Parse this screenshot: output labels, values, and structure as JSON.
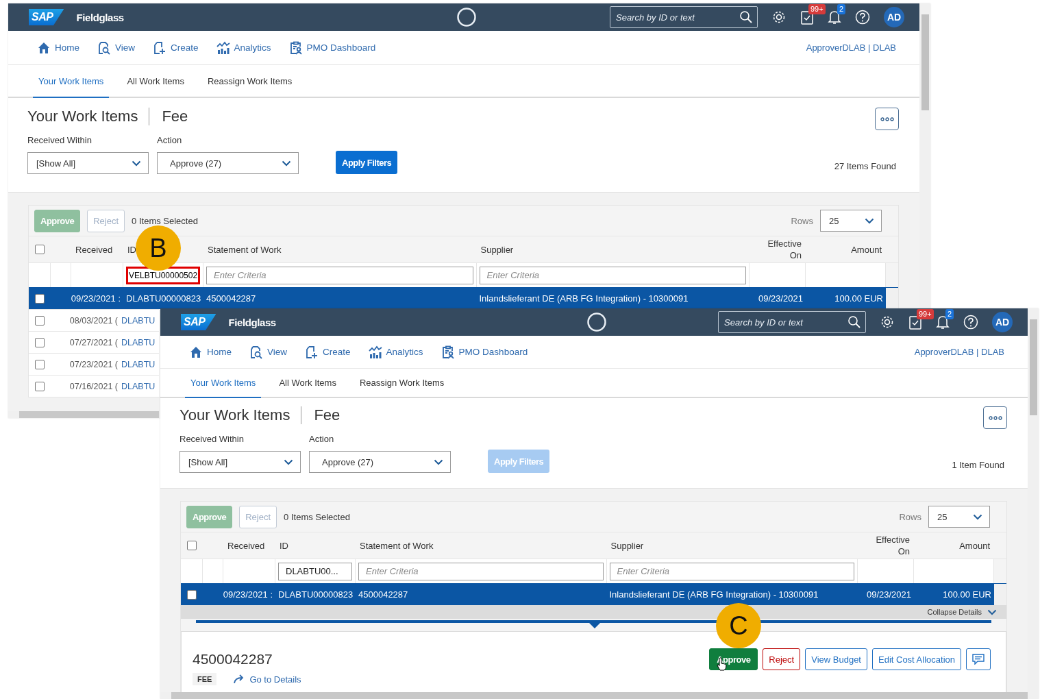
{
  "screens": [
    {
      "header": {
        "logo": "SAP",
        "product": "Fieldglass",
        "search": {
          "placeholder": "Search by ID or text"
        },
        "tasks_badge": "99+",
        "alerts_badge": "2",
        "avatar": "AD"
      },
      "nav": [
        {
          "label": "Home",
          "kind": "home"
        },
        {
          "label": "View",
          "kind": "view"
        },
        {
          "label": "Create",
          "kind": "create"
        },
        {
          "label": "Analytics",
          "kind": "analytics"
        },
        {
          "label": "PMO Dashboard",
          "kind": "dashboard"
        }
      ],
      "user": "ApproverDLAB | DLAB",
      "tabs": [
        {
          "label": "Your Work Items",
          "selected": true
        },
        {
          "label": "All Work Items",
          "selected": false
        },
        {
          "label": "Reassign Work Items",
          "selected": false
        }
      ],
      "title": "Your Work Items",
      "subtitle": "Fee",
      "filters": [
        {
          "label": "Received Within",
          "value": "[Show All]"
        },
        {
          "label": "Action",
          "value": "Approve (27)"
        }
      ],
      "apply_button": {
        "label": "Apply Filters",
        "disabled": false
      },
      "items_found": "27 Items Found",
      "toolbar": {
        "buttons": [
          {
            "label": "Approve",
            "kind": "approve",
            "disabled": true
          },
          {
            "label": "Reject",
            "kind": "reject",
            "disabled": true
          }
        ],
        "selected_count": "0 Items Selected",
        "rows_label": "Rows",
        "rows_value": "25"
      },
      "select_all": {
        "checked": false
      },
      "columns": [
        "Received",
        "ID",
        "Statement of Work",
        "Supplier",
        "Effective On",
        "Amount"
      ],
      "id_filter": {
        "value": "VELBTU00000502",
        "highlighted": true
      },
      "sow_filter": {
        "placeholder": "Enter Criteria"
      },
      "supplier_filter": {
        "placeholder": "Enter Criteria"
      },
      "rows": [
        {
          "received": "09/23/2021 :",
          "id": "DLABTU00000823",
          "statement_of_work": "4500042287",
          "supplier": "Inlandslieferant DE (ARB FG Integration) - 10300091",
          "effective_on": "09/23/2021",
          "amount": "100.00 EUR",
          "selected": true
        },
        {
          "received": "08/03/2021 (",
          "id": "DLABTU",
          "selected": false
        },
        {
          "received": "07/27/2021 (",
          "id": "DLABTU",
          "selected": false
        },
        {
          "received": "07/23/2021 (",
          "id": "DLABTU",
          "selected": false
        },
        {
          "received": "07/16/2021 (",
          "id": "DLABTU",
          "selected": false
        }
      ],
      "marker": "B"
    },
    {
      "header": {
        "logo": "SAP",
        "product": "Fieldglass",
        "search": {
          "placeholder": "Search by ID or text"
        },
        "tasks_badge": "99+",
        "alerts_badge": "2",
        "avatar": "AD"
      },
      "nav": [
        {
          "label": "Home",
          "kind": "home"
        },
        {
          "label": "View",
          "kind": "view"
        },
        {
          "label": "Create",
          "kind": "create"
        },
        {
          "label": "Analytics",
          "kind": "analytics"
        },
        {
          "label": "PMO Dashboard",
          "kind": "dashboard"
        }
      ],
      "user": "ApproverDLAB | DLAB",
      "tabs": [
        {
          "label": "Your Work Items",
          "selected": true
        },
        {
          "label": "All Work Items",
          "selected": false
        },
        {
          "label": "Reassign Work Items",
          "selected": false
        }
      ],
      "title": "Your Work Items",
      "subtitle": "Fee",
      "filters": [
        {
          "label": "Received Within",
          "value": "[Show All]"
        },
        {
          "label": "Action",
          "value": "Approve (27)"
        }
      ],
      "apply_button": {
        "label": "Apply Filters",
        "disabled": true
      },
      "items_found": "1 Item Found",
      "toolbar": {
        "buttons": [
          {
            "label": "Approve",
            "kind": "approve",
            "disabled": true
          },
          {
            "label": "Reject",
            "kind": "reject",
            "disabled": true
          }
        ],
        "selected_count": "0 Items Selected",
        "rows_label": "Rows",
        "rows_value": "25"
      },
      "select_all": {
        "checked": false
      },
      "columns": [
        "Received",
        "ID",
        "Statement of Work",
        "Supplier",
        "Effective On",
        "Amount"
      ],
      "id_filter": {
        "value": "DLABTU00...",
        "highlighted": false
      },
      "sow_filter": {
        "placeholder": "Enter Criteria"
      },
      "supplier_filter": {
        "placeholder": "Enter Criteria"
      },
      "rows": [
        {
          "received": "09/23/2021 :",
          "id": "DLABTU00000823",
          "statement_of_work": "4500042287",
          "supplier": "Inlandslieferant DE (ARB FG Integration) - 10300091",
          "effective_on": "09/23/2021",
          "amount": "100.00 EUR",
          "selected": true
        }
      ],
      "details": {
        "collapse": "Collapse Details",
        "number": "4500042287",
        "tag": "FEE",
        "link": "Go to Details",
        "buttons": [
          {
            "label": "Approve",
            "kind": "approve"
          },
          {
            "label": "Reject",
            "kind": "reject"
          },
          {
            "label": "View Budget",
            "kind": "outline"
          },
          {
            "label": "Edit Cost Allocation",
            "kind": "outline"
          },
          {
            "kind": "comment"
          }
        ]
      },
      "marker": "C"
    }
  ]
}
